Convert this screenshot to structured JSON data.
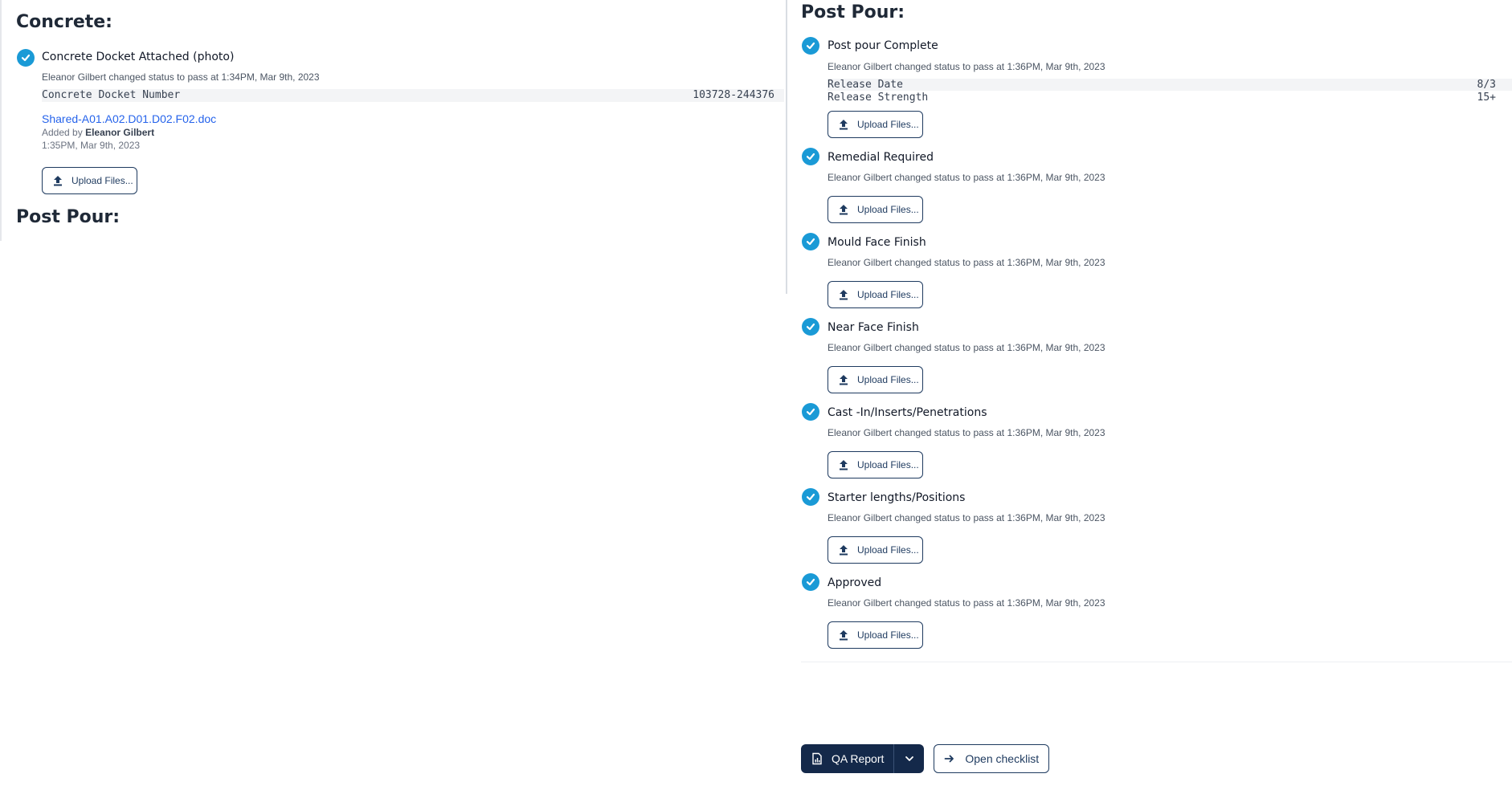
{
  "left": {
    "section_concrete": "Concrete:",
    "docket": {
      "title": "Concrete Docket Attached (photo)",
      "status": "Eleanor Gilbert changed status to pass at 1:34PM, Mar 9th, 2023",
      "field_label": "Concrete Docket Number",
      "field_value": "103728-244376",
      "file_name": "Shared-A01.A02.D01.D02.F02.doc",
      "added_by_prefix": "Added by",
      "added_by_name": "Eleanor Gilbert",
      "added_time": "1:35PM, Mar 9th, 2023",
      "upload_label": "Upload Files..."
    },
    "section_post_pour": "Post Pour:"
  },
  "right": {
    "section_post_pour": "Post Pour:",
    "items": [
      {
        "title": "Post pour Complete",
        "status": "Eleanor Gilbert changed status to pass at 1:36PM, Mar 9th, 2023",
        "fields": [
          {
            "label": "Release Date",
            "value": "8/3"
          },
          {
            "label": "Release Strength",
            "value": "15+"
          }
        ],
        "upload_label": "Upload Files..."
      },
      {
        "title": "Remedial Required",
        "status": "Eleanor Gilbert changed status to pass at 1:36PM, Mar 9th, 2023",
        "upload_label": "Upload Files..."
      },
      {
        "title": "Mould Face Finish",
        "status": "Eleanor Gilbert changed status to pass at 1:36PM, Mar 9th, 2023",
        "upload_label": "Upload Files..."
      },
      {
        "title": "Near Face Finish",
        "status": "Eleanor Gilbert changed status to pass at 1:36PM, Mar 9th, 2023",
        "upload_label": "Upload Files..."
      },
      {
        "title": "Cast -In/Inserts/Penetrations",
        "status": "Eleanor Gilbert changed status to pass at 1:36PM, Mar 9th, 2023",
        "upload_label": "Upload Files..."
      },
      {
        "title": "Starter lengths/Positions",
        "status": "Eleanor Gilbert changed status to pass at 1:36PM, Mar 9th, 2023",
        "upload_label": "Upload Files..."
      },
      {
        "title": "Approved",
        "status": "Eleanor Gilbert changed status to pass at 1:36PM, Mar 9th, 2023",
        "upload_label": "Upload Files..."
      }
    ]
  },
  "actions": {
    "qa_report_label": "QA Report",
    "open_checklist_label": "Open checklist"
  },
  "icons": {
    "check": "check-circle-icon",
    "upload": "upload-icon",
    "report": "report-chart-icon",
    "caret": "chevron-down-icon",
    "arrow": "arrow-right-icon"
  },
  "colors": {
    "accent_check": "#1a9ad6",
    "primary_dark": "#14294a",
    "link": "#2563eb"
  }
}
